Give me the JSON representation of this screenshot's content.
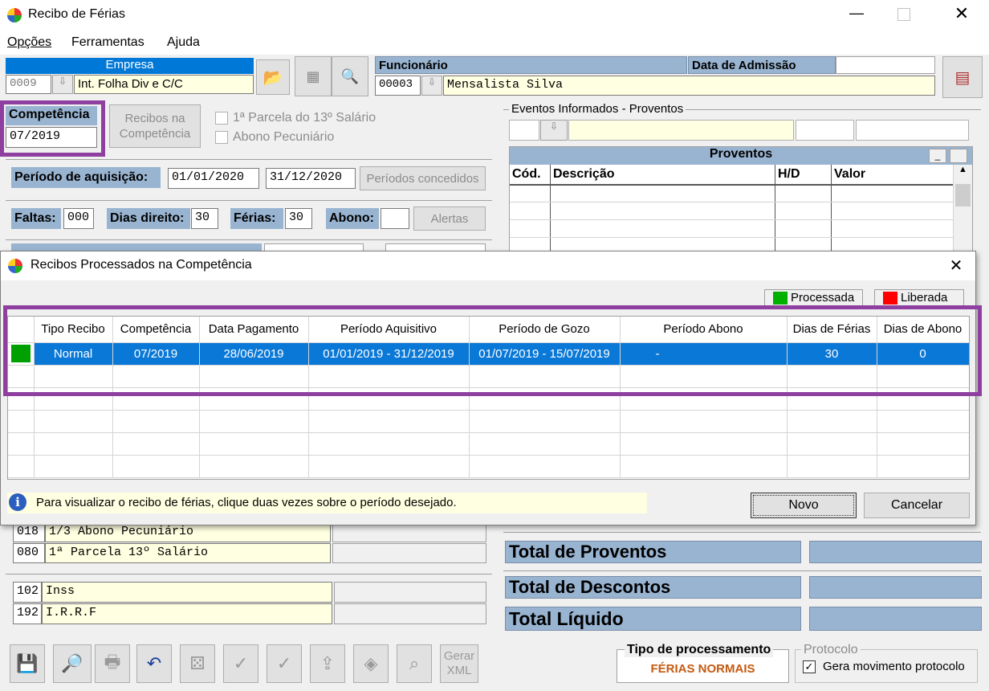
{
  "window": {
    "title": "Recibo de Férias"
  },
  "menu": [
    "Opções",
    "Ferramentas",
    "Ajuda"
  ],
  "empresa": {
    "header": "Empresa",
    "code": "0009",
    "name": "Int. Folha Div e C/C"
  },
  "funcionario": {
    "header": "Funcionário",
    "admissao_header": "Data de Admissão",
    "code": "00003",
    "name": "Mensalista Silva"
  },
  "competencia": {
    "label": "Competência",
    "value": "07/2019",
    "recibos_button": "Recibos na Competência"
  },
  "options": {
    "parcela13": "1ª Parcela do 13º Salário",
    "abono": "Abono Pecuniário"
  },
  "periodo": {
    "label": "Período de aquisição:",
    "start": "01/01/2020",
    "end": "31/12/2020",
    "button": "Períodos concedidos"
  },
  "counts": {
    "faltas_label": "Faltas:",
    "faltas": "000",
    "dias_label": "Dias direito:",
    "dias": "30",
    "ferias_label": "Férias:",
    "ferias": "30",
    "abono_label": "Abono:",
    "abono": "",
    "alertas": "Alertas"
  },
  "eventos": {
    "title": "Eventos Informados - Proventos",
    "grid_title": "Proventos",
    "columns": [
      "Cód.",
      "Descrição",
      "H/D",
      "Valor"
    ]
  },
  "left_events": [
    {
      "code": "018",
      "desc": "1/3 Abono Pecuniário"
    },
    {
      "code": "080",
      "desc": "1ª Parcela 13º Salário"
    },
    {
      "code": "102",
      "desc": "Inss"
    },
    {
      "code": "192",
      "desc": "I.R.R.F"
    }
  ],
  "totals": {
    "proventos": "Total de Proventos",
    "descontos": "Total de Descontos",
    "liquido": "Total Líquido"
  },
  "toolbar": {
    "gerar_xml": "Gerar XML"
  },
  "processamento": {
    "label": "Tipo de processamento",
    "value": "FÉRIAS NORMAIS"
  },
  "protocolo": {
    "title": "Protocolo",
    "checkbox": "Gera movimento protocolo",
    "checked": true
  },
  "dialog": {
    "title": "Recibos Processados na Competência",
    "legend": [
      {
        "label": "Processada",
        "color": "#00b000"
      },
      {
        "label": "Liberada",
        "color": "#ff0000"
      }
    ],
    "columns": [
      "",
      "Tipo Recibo",
      "Competência",
      "Data Pagamento",
      "Período Aquisitivo",
      "Período de Gozo",
      "Período Abono",
      "Dias de Férias",
      "Dias de Abono"
    ],
    "rows": [
      [
        "",
        "Normal",
        "07/2019",
        "28/06/2019",
        "01/01/2019 - 31/12/2019",
        "01/07/2019 - 15/07/2019",
        "-",
        "30",
        "0"
      ]
    ],
    "info": "Para visualizar o recibo de férias, clique duas vezes sobre o período desejado.",
    "novo": "Novo",
    "cancelar": "Cancelar"
  }
}
